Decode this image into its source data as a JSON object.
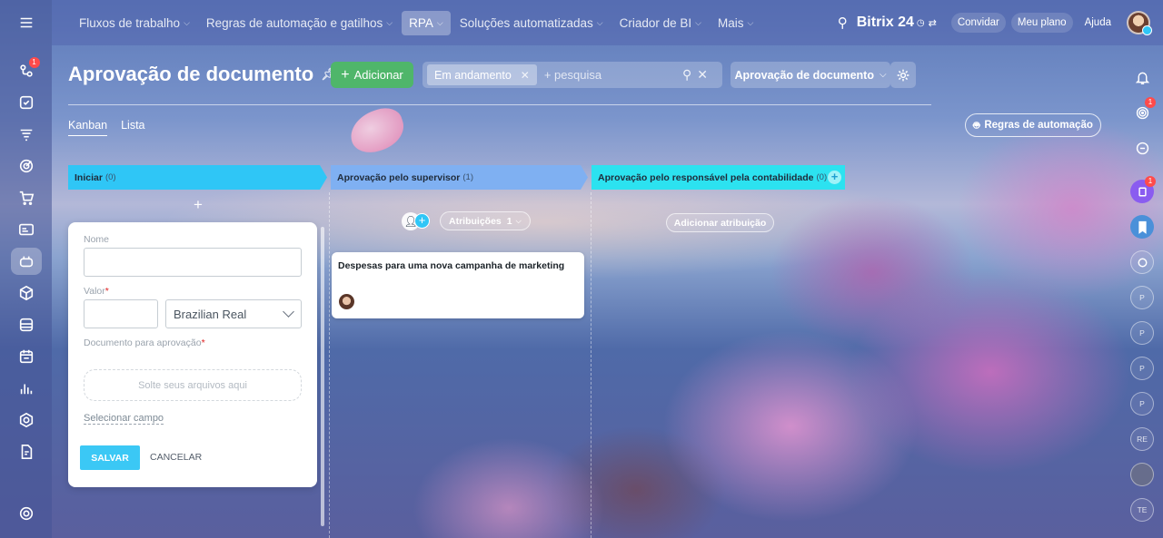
{
  "topbar": {
    "menu": [
      {
        "label": "Fluxos de trabalho"
      },
      {
        "label": "Regras de automação e gatilhos"
      },
      {
        "label": "RPA"
      },
      {
        "label": "Soluções automatizadas"
      },
      {
        "label": "Criador de BI"
      },
      {
        "label": "Mais"
      }
    ],
    "brand": "Bitrix 24",
    "invite": "Convidar",
    "plan": "Meu plano",
    "help": "Ajuda"
  },
  "left_rail": {
    "counter": "1"
  },
  "right_rail": {
    "counter_a": "1",
    "counter_b": "1",
    "avatars": [
      "P",
      "P",
      "P",
      "P",
      "RE",
      "TE"
    ]
  },
  "header": {
    "title": "Aprovação de documento",
    "add_label": "Adicionar",
    "filter_chip": "Em andamento",
    "search_placeholder": "+ pesquisa",
    "category": "Aprovação de documento"
  },
  "tabs": {
    "kanban": "Kanban",
    "list": "Lista"
  },
  "robots_label": "Regras de automação",
  "columns": [
    {
      "name": "Iniciar",
      "count": "(0)",
      "color": "#2fc6f6"
    },
    {
      "name": "Aprovação pelo supervisor",
      "count": "(1)",
      "color": "#7fb0f2"
    },
    {
      "name": "Aprovação pelo responsável pela contabilidade",
      "count": "(0)",
      "color": "#2ce2f0"
    }
  ],
  "quick_form": {
    "name_label": "Nome",
    "name_value": "",
    "value_label": "Valor",
    "value_amount": "",
    "currency": "Brazilian Real",
    "doc_label": "Documento para aprovação",
    "drop_text": "Solte seus arquivos aqui",
    "select_field": "Selecionar campo",
    "save": "SALVAR",
    "cancel": "CANCELAR"
  },
  "column2": {
    "assignments_label": "Atribuições",
    "assignments_count": "1",
    "card_title": "Despesas para uma nova campanha de marketing"
  },
  "column3": {
    "add_assignment": "Adicionar atribuição"
  }
}
